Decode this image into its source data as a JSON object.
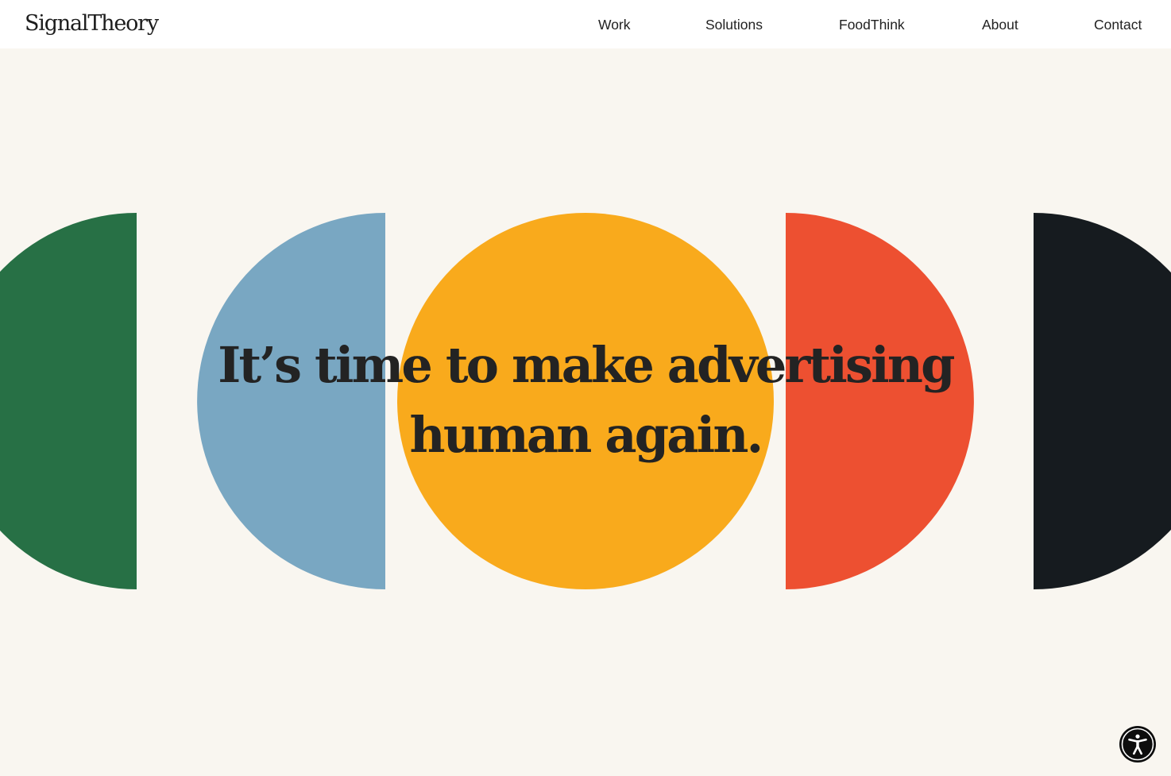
{
  "header": {
    "logo_text": "SignalTheory",
    "nav": [
      {
        "label": "Work"
      },
      {
        "label": "Solutions"
      },
      {
        "label": "FoodThink"
      },
      {
        "label": "About"
      },
      {
        "label": "Contact"
      }
    ]
  },
  "hero": {
    "headline_line1": "It’s time to make advertising",
    "headline_line2": "human again."
  },
  "colors": {
    "background": "#f9f6f0",
    "header_bg": "#ffffff",
    "green": "#277045",
    "blue": "#79a7c2",
    "yellow": "#f9aa1c",
    "red": "#ed5031",
    "black": "#161b1f"
  },
  "icons": {
    "accessibility": "accessibility-icon"
  }
}
